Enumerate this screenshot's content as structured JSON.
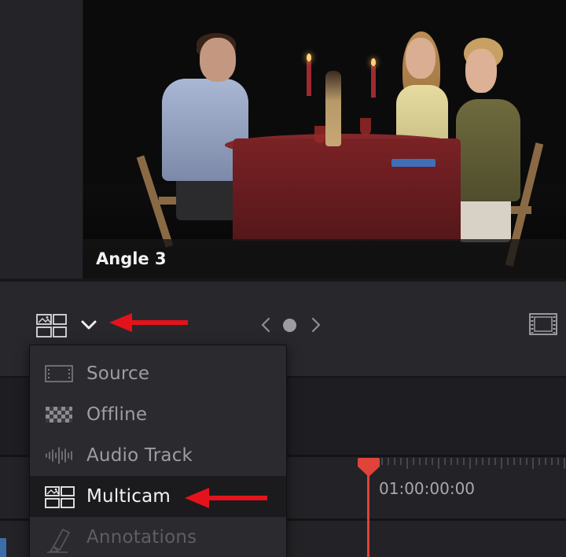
{
  "viewer": {
    "angle_label": "Angle 3"
  },
  "toolbar": {
    "mode_icon": "multicam-icon",
    "dropdown_icon": "chevron-down-icon",
    "prev_icon": "chevron-left-icon",
    "next_icon": "chevron-right-icon",
    "filmstrip_icon": "filmstrip-icon"
  },
  "menu": {
    "items": [
      {
        "label": "Source",
        "icon": "source-icon",
        "state": "normal"
      },
      {
        "label": "Offline",
        "icon": "checkerboard-icon",
        "state": "normal"
      },
      {
        "label": "Audio Track",
        "icon": "waveform-icon",
        "state": "normal"
      },
      {
        "label": "Multicam",
        "icon": "multicam-icon",
        "state": "selected"
      },
      {
        "label": "Annotations",
        "icon": "marker-icon",
        "state": "disabled"
      }
    ]
  },
  "timeline": {
    "timecode": "01:00:00:00"
  },
  "colors": {
    "accent_red": "#e0433a",
    "callout_arrow": "#e4131b",
    "background": "#1c1c1f"
  }
}
